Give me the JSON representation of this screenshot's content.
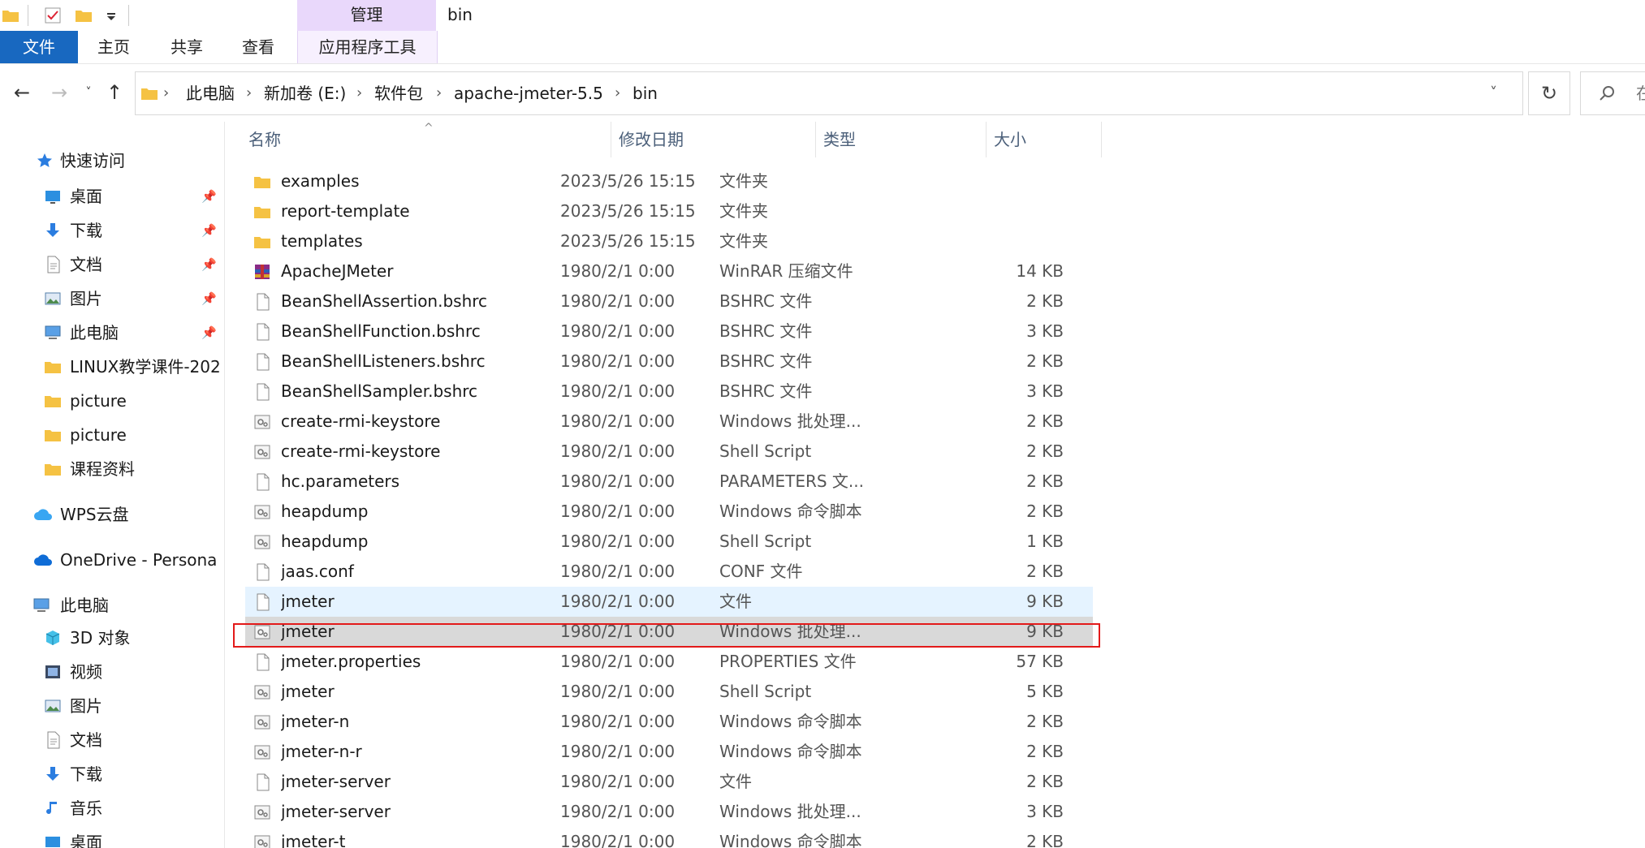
{
  "window": {
    "title": "bin"
  },
  "ribbon": {
    "tabs": [
      "文件",
      "主页",
      "共享",
      "查看"
    ],
    "context_group": "管理",
    "context_tab": "应用程序工具"
  },
  "address": {
    "breadcrumbs": [
      "此电脑",
      "新加卷 (E:)",
      "软件包",
      "apache-jmeter-5.5",
      "bin"
    ],
    "search_placeholder": "在"
  },
  "sidebar": {
    "quick_access": "快速访问",
    "quick_items": [
      {
        "label": "桌面",
        "pinned": true,
        "icon": "desktop-icon"
      },
      {
        "label": "下载",
        "pinned": true,
        "icon": "download-icon"
      },
      {
        "label": "文档",
        "pinned": true,
        "icon": "document-icon"
      },
      {
        "label": "图片",
        "pinned": true,
        "icon": "picture-icon"
      },
      {
        "label": "此电脑",
        "pinned": true,
        "icon": "computer-icon"
      },
      {
        "label": "LINUX教学课件-202",
        "pinned": false,
        "icon": "folder-icon"
      },
      {
        "label": "picture",
        "pinned": false,
        "icon": "folder-icon"
      },
      {
        "label": "picture",
        "pinned": false,
        "icon": "folder-icon"
      },
      {
        "label": "课程资料",
        "pinned": false,
        "icon": "folder-icon"
      }
    ],
    "wps": "WPS云盘",
    "onedrive": "OneDrive - Persona",
    "this_pc": "此电脑",
    "pc_items": [
      {
        "label": "3D 对象",
        "icon": "3d-objects-icon"
      },
      {
        "label": "视频",
        "icon": "video-icon"
      },
      {
        "label": "图片",
        "icon": "picture-icon"
      },
      {
        "label": "文档",
        "icon": "document-icon"
      },
      {
        "label": "下载",
        "icon": "download-icon"
      },
      {
        "label": "音乐",
        "icon": "music-icon"
      },
      {
        "label": "桌面",
        "icon": "desktop-icon"
      }
    ]
  },
  "columns": {
    "name": "名称",
    "date": "修改日期",
    "type": "类型",
    "size": "大小"
  },
  "files": [
    {
      "name": "examples",
      "date": "2023/5/26 15:15",
      "type": "文件夹",
      "size": "",
      "icon": "folder"
    },
    {
      "name": "report-template",
      "date": "2023/5/26 15:15",
      "type": "文件夹",
      "size": "",
      "icon": "folder"
    },
    {
      "name": "templates",
      "date": "2023/5/26 15:15",
      "type": "文件夹",
      "size": "",
      "icon": "folder"
    },
    {
      "name": "ApacheJMeter",
      "date": "1980/2/1 0:00",
      "type": "WinRAR 压缩文件",
      "size": "14 KB",
      "icon": "archive"
    },
    {
      "name": "BeanShellAssertion.bshrc",
      "date": "1980/2/1 0:00",
      "type": "BSHRC 文件",
      "size": "2 KB",
      "icon": "file"
    },
    {
      "name": "BeanShellFunction.bshrc",
      "date": "1980/2/1 0:00",
      "type": "BSHRC 文件",
      "size": "3 KB",
      "icon": "file"
    },
    {
      "name": "BeanShellListeners.bshrc",
      "date": "1980/2/1 0:00",
      "type": "BSHRC 文件",
      "size": "2 KB",
      "icon": "file"
    },
    {
      "name": "BeanShellSampler.bshrc",
      "date": "1980/2/1 0:00",
      "type": "BSHRC 文件",
      "size": "3 KB",
      "icon": "file"
    },
    {
      "name": "create-rmi-keystore",
      "date": "1980/2/1 0:00",
      "type": "Windows 批处理...",
      "size": "2 KB",
      "icon": "script"
    },
    {
      "name": "create-rmi-keystore",
      "date": "1980/2/1 0:00",
      "type": "Shell Script",
      "size": "2 KB",
      "icon": "script"
    },
    {
      "name": "hc.parameters",
      "date": "1980/2/1 0:00",
      "type": "PARAMETERS 文...",
      "size": "2 KB",
      "icon": "file"
    },
    {
      "name": "heapdump",
      "date": "1980/2/1 0:00",
      "type": "Windows 命令脚本",
      "size": "2 KB",
      "icon": "script"
    },
    {
      "name": "heapdump",
      "date": "1980/2/1 0:00",
      "type": "Shell Script",
      "size": "1 KB",
      "icon": "script"
    },
    {
      "name": "jaas.conf",
      "date": "1980/2/1 0:00",
      "type": "CONF 文件",
      "size": "2 KB",
      "icon": "file"
    },
    {
      "name": "jmeter",
      "date": "1980/2/1 0:00",
      "type": "文件",
      "size": "9 KB",
      "icon": "file",
      "state": "hover"
    },
    {
      "name": "jmeter",
      "date": "1980/2/1 0:00",
      "type": "Windows 批处理...",
      "size": "9 KB",
      "icon": "script",
      "state": "selected"
    },
    {
      "name": "jmeter.properties",
      "date": "1980/2/1 0:00",
      "type": "PROPERTIES 文件",
      "size": "57 KB",
      "icon": "file"
    },
    {
      "name": "jmeter",
      "date": "1980/2/1 0:00",
      "type": "Shell Script",
      "size": "5 KB",
      "icon": "script"
    },
    {
      "name": "jmeter-n",
      "date": "1980/2/1 0:00",
      "type": "Windows 命令脚本",
      "size": "2 KB",
      "icon": "script"
    },
    {
      "name": "jmeter-n-r",
      "date": "1980/2/1 0:00",
      "type": "Windows 命令脚本",
      "size": "2 KB",
      "icon": "script"
    },
    {
      "name": "jmeter-server",
      "date": "1980/2/1 0:00",
      "type": "文件",
      "size": "2 KB",
      "icon": "file"
    },
    {
      "name": "jmeter-server",
      "date": "1980/2/1 0:00",
      "type": "Windows 批处理...",
      "size": "3 KB",
      "icon": "script"
    },
    {
      "name": "jmeter-t",
      "date": "1980/2/1 0:00",
      "type": "Windows 命令脚本",
      "size": "2 KB",
      "icon": "script"
    }
  ],
  "colors": {
    "accent": "#1868c0",
    "selection": "#d9d9d9",
    "hover": "#e5f3ff",
    "highlight_box": "#e31a1a",
    "folder": "#f5c243"
  }
}
